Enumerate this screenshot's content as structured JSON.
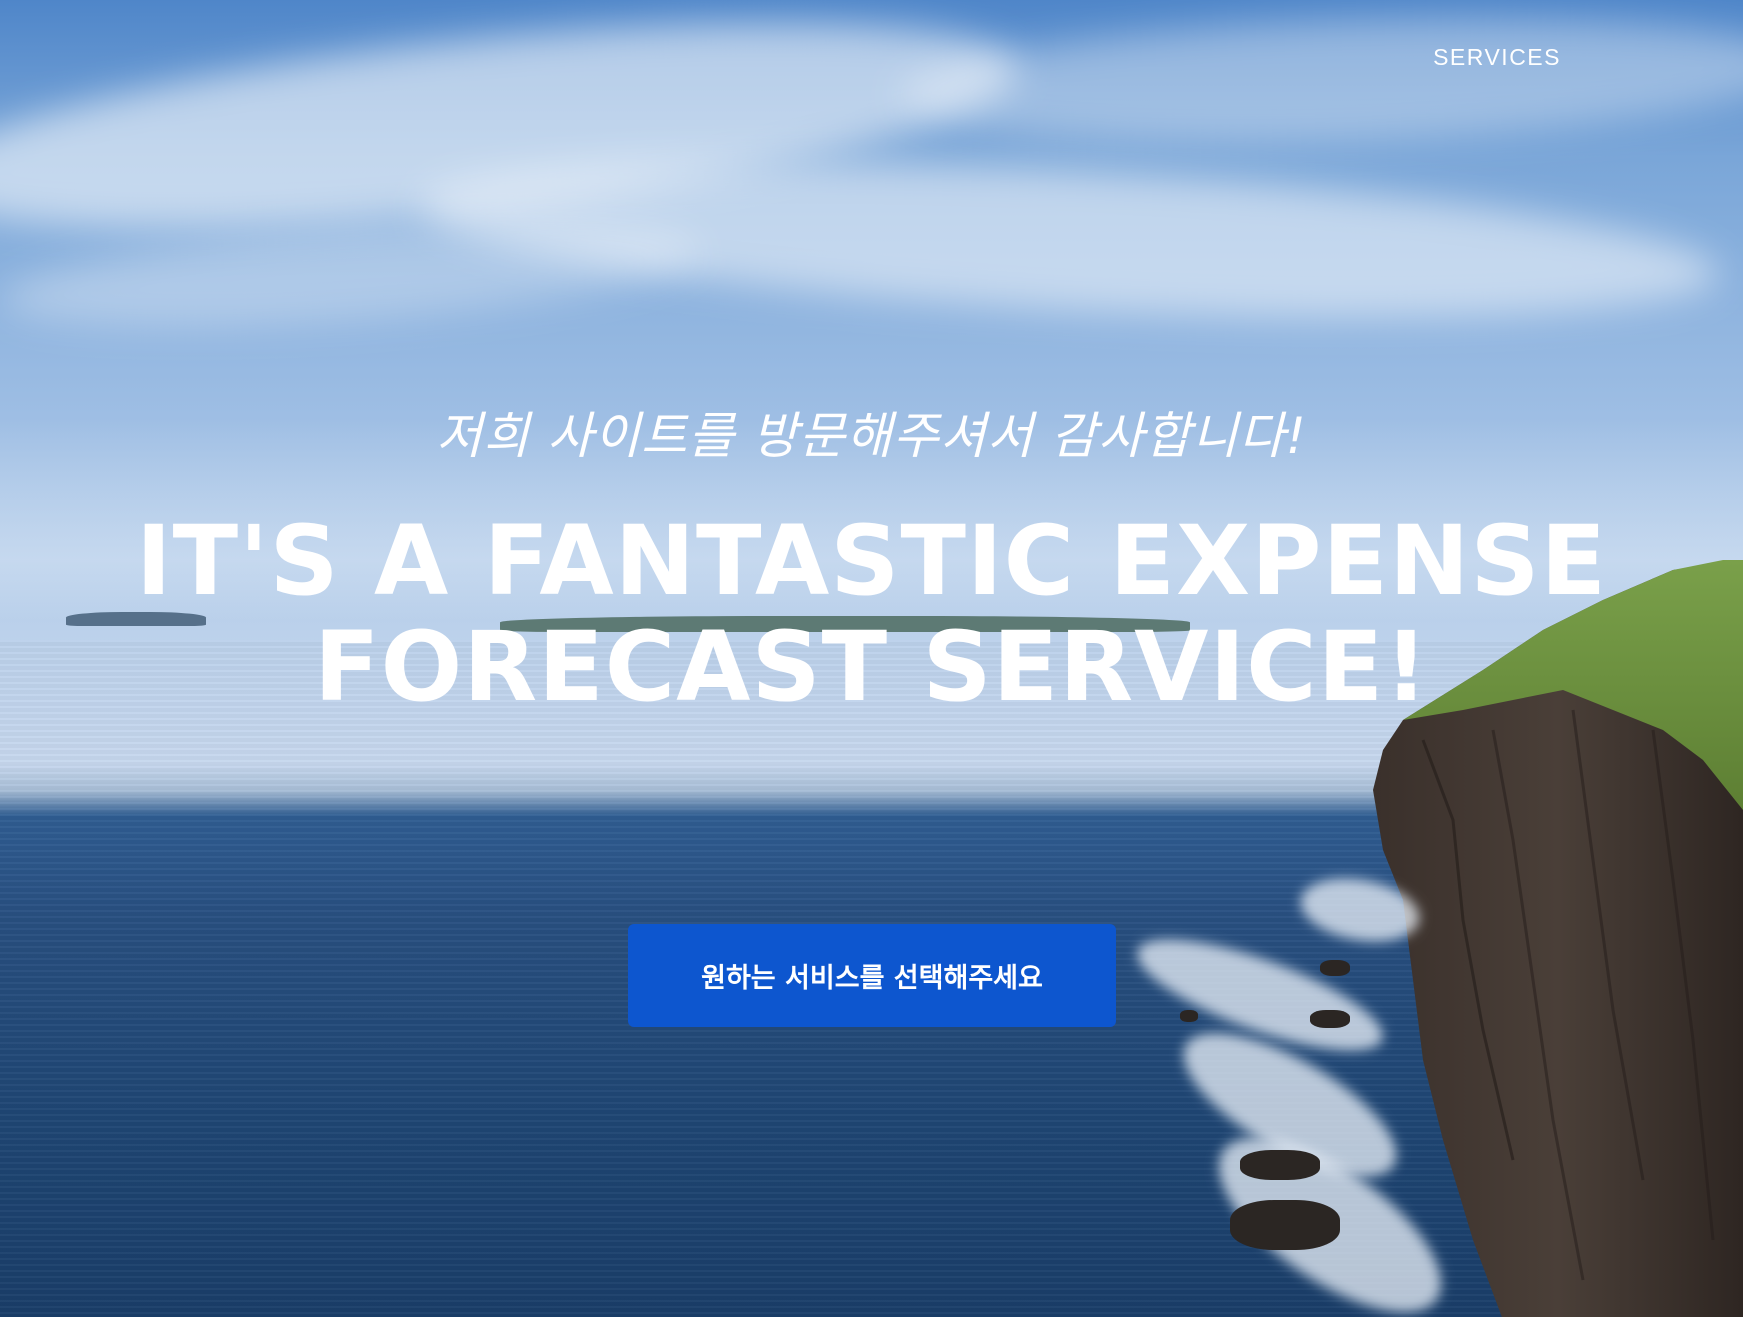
{
  "nav": {
    "services_label": "SERVICES"
  },
  "hero": {
    "subtitle": "저희 사이트를 방문해주셔서 감사합니다!",
    "headline": "IT'S A FANTASTIC EXPENSE FORECAST SERVICE!",
    "cta_label": "원하는 서비스를 선택해주세요"
  },
  "colors": {
    "cta_background": "#0d56cf",
    "text": "#ffffff"
  }
}
